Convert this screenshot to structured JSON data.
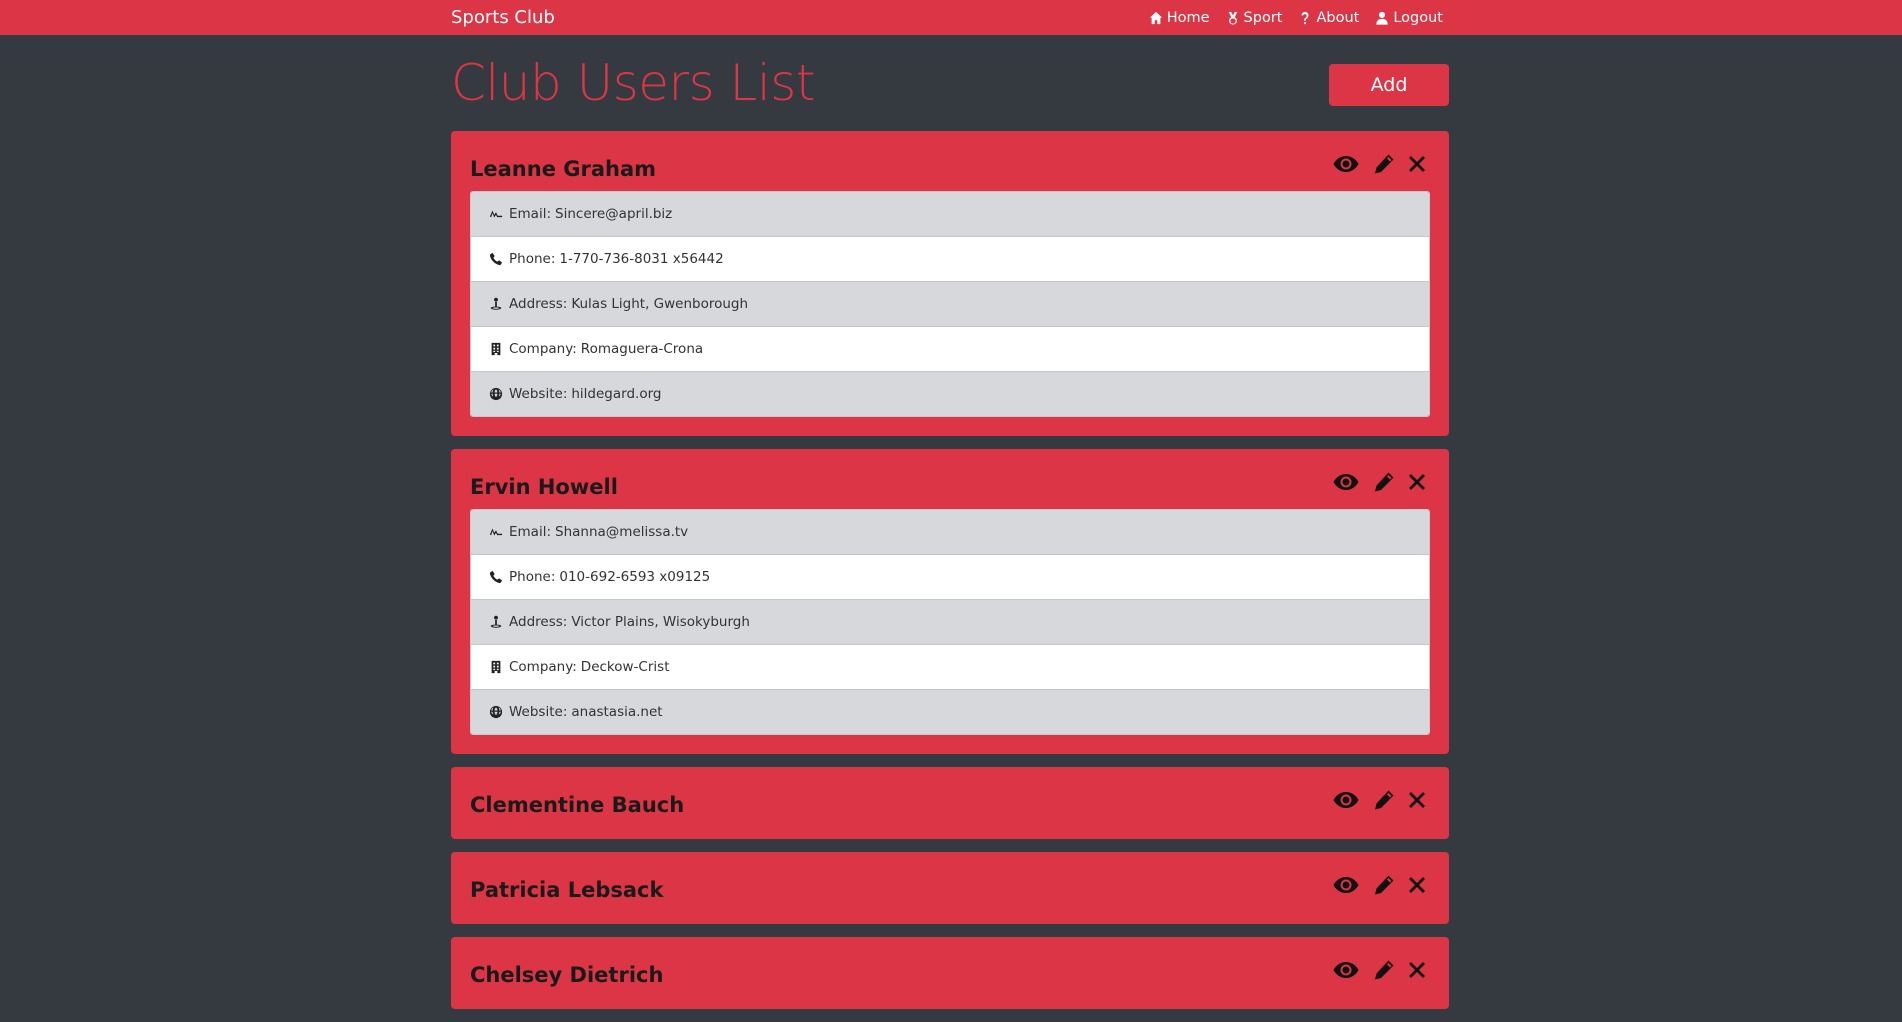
{
  "nav": {
    "brand": "Sports Club",
    "links": [
      {
        "label": "Home",
        "icon": "home-icon"
      },
      {
        "label": "Sport",
        "icon": "medal-icon"
      },
      {
        "label": "About",
        "icon": "question-icon"
      },
      {
        "label": "Logout",
        "icon": "user-icon"
      }
    ]
  },
  "page": {
    "title": "Club Users List",
    "add_label": "Add"
  },
  "colors": {
    "accent": "#dc3545",
    "background": "#343a40",
    "row_shade": "#d7d8db"
  },
  "users": [
    {
      "name": "Leanne Graham",
      "expanded": true,
      "details": [
        {
          "label": "Email:",
          "value": "Sincere@april.biz",
          "icon": "signature-icon"
        },
        {
          "label": "Phone:",
          "value": "1-770-736-8031 x56442",
          "icon": "phone-icon"
        },
        {
          "label": "Address:",
          "value": "Kulas Light, Gwenborough",
          "icon": "location-icon"
        },
        {
          "label": "Company:",
          "value": "Romaguera-Crona",
          "icon": "building-icon"
        },
        {
          "label": "Website:",
          "value": "hildegard.org",
          "icon": "globe-icon"
        }
      ]
    },
    {
      "name": "Ervin Howell",
      "expanded": true,
      "details": [
        {
          "label": "Email:",
          "value": "Shanna@melissa.tv",
          "icon": "signature-icon"
        },
        {
          "label": "Phone:",
          "value": "010-692-6593 x09125",
          "icon": "phone-icon"
        },
        {
          "label": "Address:",
          "value": "Victor Plains, Wisokyburgh",
          "icon": "location-icon"
        },
        {
          "label": "Company:",
          "value": "Deckow-Crist",
          "icon": "building-icon"
        },
        {
          "label": "Website:",
          "value": "anastasia.net",
          "icon": "globe-icon"
        }
      ]
    },
    {
      "name": "Clementine Bauch",
      "expanded": false
    },
    {
      "name": "Patricia Lebsack",
      "expanded": false
    },
    {
      "name": "Chelsey Dietrich",
      "expanded": false
    }
  ]
}
